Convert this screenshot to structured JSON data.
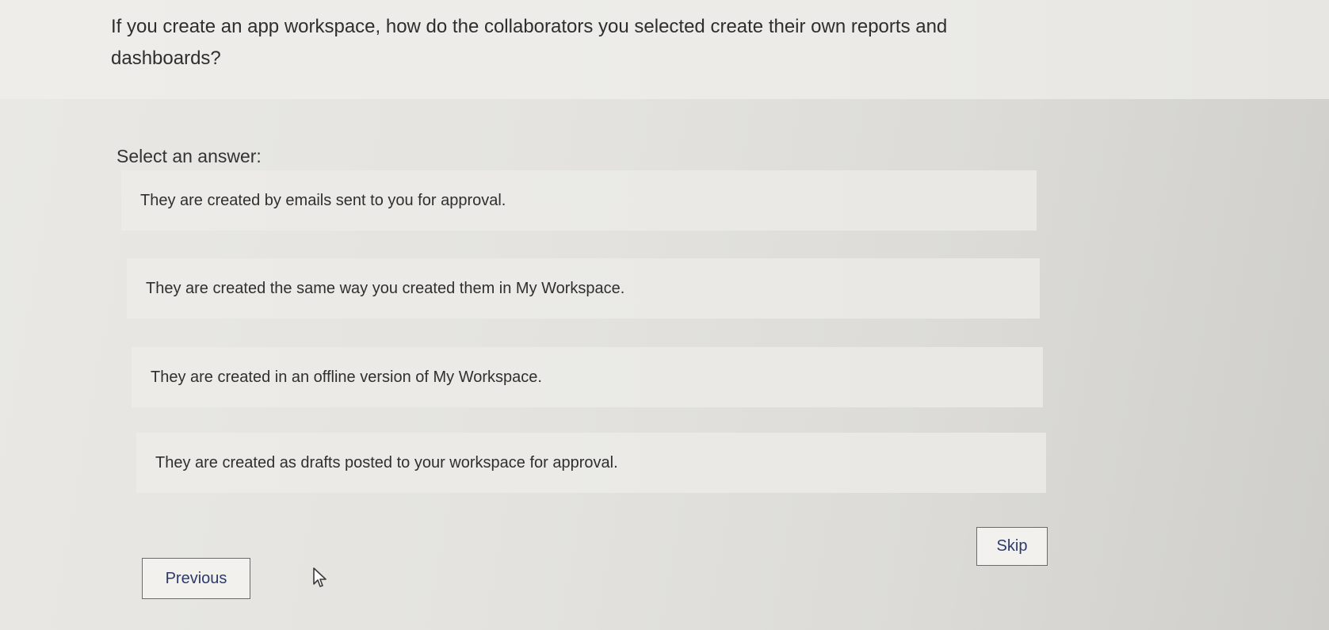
{
  "question": {
    "text": "If you create an app workspace, how do the collaborators you selected create their own reports and dashboards?"
  },
  "prompt": "Select an answer:",
  "answers": [
    {
      "label": "They are created by emails sent to you for approval."
    },
    {
      "label": "They are created the same way you created them in My Workspace."
    },
    {
      "label": "They are created in an offline version of My Workspace."
    },
    {
      "label": "They are created as drafts posted to your workspace for approval."
    }
  ],
  "buttons": {
    "skip": "Skip",
    "previous": "Previous"
  },
  "icons": {
    "cursor": "mouse-pointer-icon"
  }
}
